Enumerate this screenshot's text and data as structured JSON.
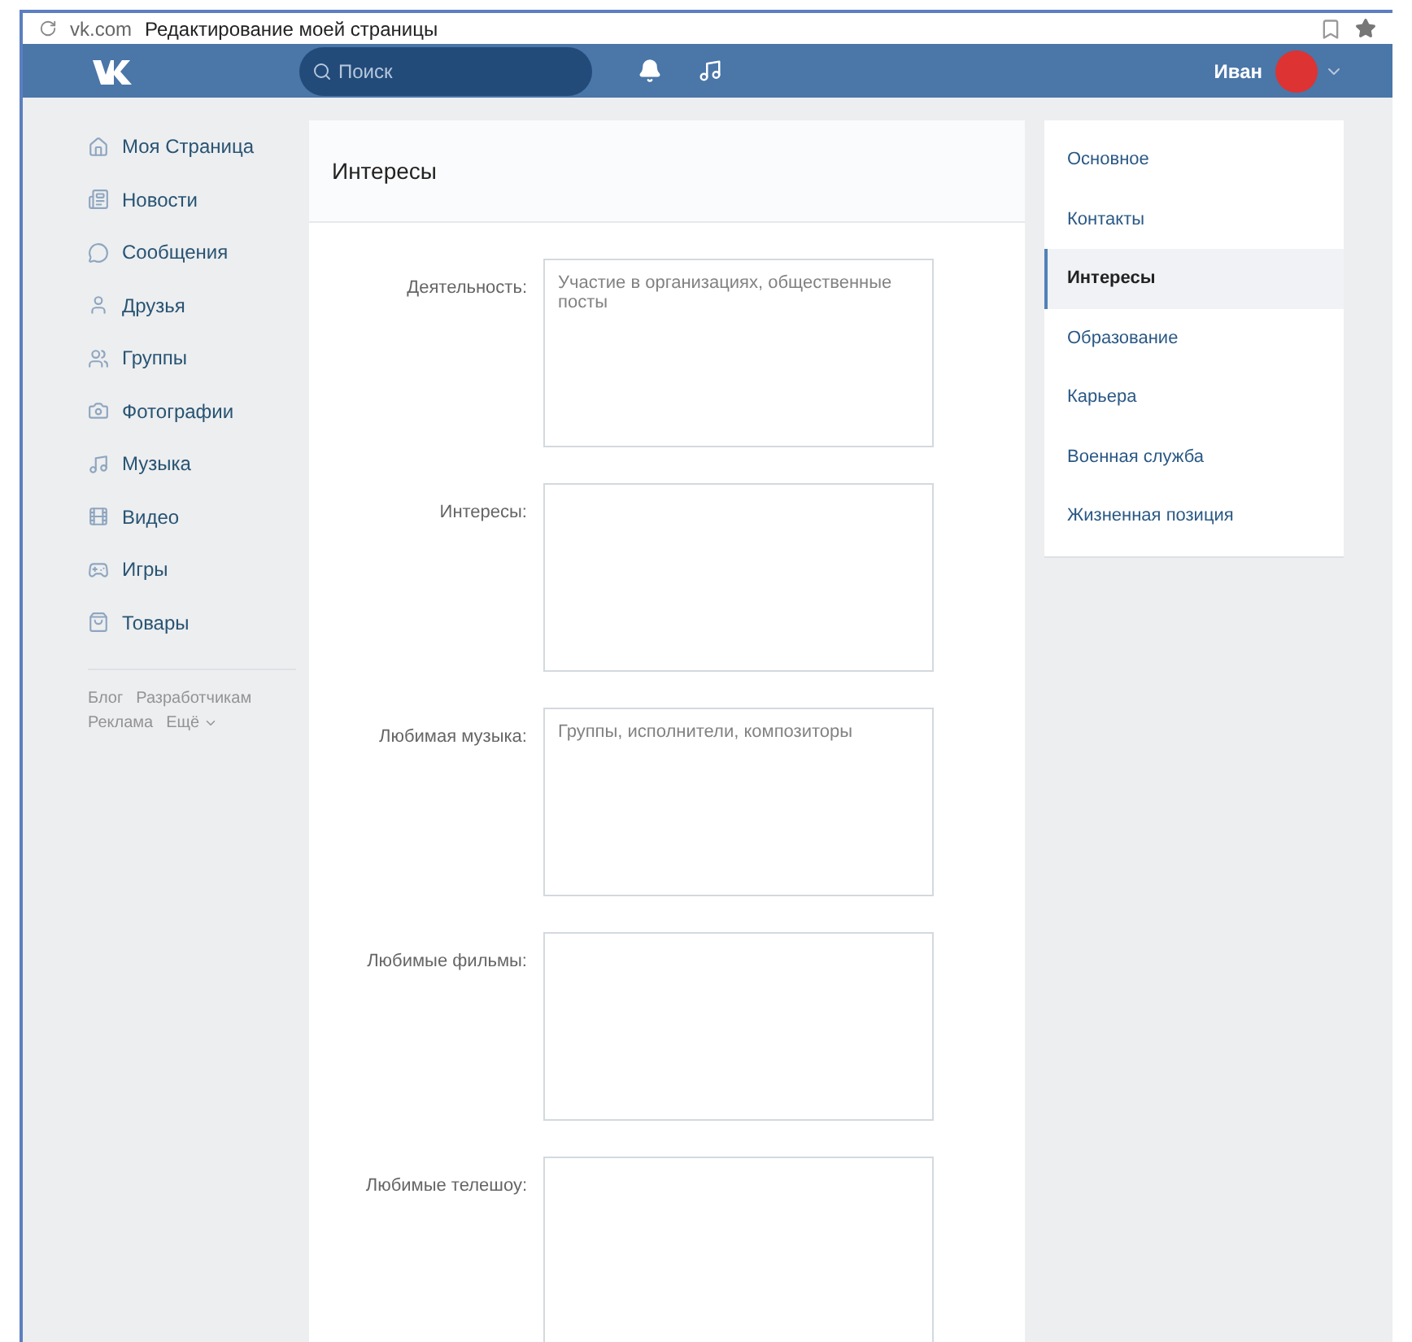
{
  "browser": {
    "domain": "vk.com",
    "title": "Редактирование моей страницы"
  },
  "header": {
    "search": {
      "placeholder": "Поиск"
    },
    "user": {
      "name": "Иван"
    }
  },
  "sidebar": {
    "items": [
      {
        "label": "Моя Страница"
      },
      {
        "label": "Новости"
      },
      {
        "label": "Сообщения"
      },
      {
        "label": "Друзья"
      },
      {
        "label": "Группы"
      },
      {
        "label": "Фотографии"
      },
      {
        "label": "Музыка"
      },
      {
        "label": "Видео"
      },
      {
        "label": "Игры"
      },
      {
        "label": "Товары"
      }
    ],
    "footer_links": [
      "Блог",
      "Разработчикам",
      "Реклама",
      "Ещё"
    ]
  },
  "panel": {
    "title": "Интересы",
    "fields": [
      {
        "label": "Деятельность:",
        "placeholder": "Участие в организациях, общественные посты"
      },
      {
        "label": "Интересы:"
      },
      {
        "label": "Любимая музыка:",
        "placeholder": "Группы, исполнители, композиторы"
      },
      {
        "label": "Любимые фильмы:"
      },
      {
        "label": "Любимые телешоу:"
      }
    ]
  },
  "nav": {
    "items": [
      {
        "label": "Основное",
        "selected": false
      },
      {
        "label": "Контакты",
        "selected": false
      },
      {
        "label": "Интересы",
        "selected": true
      },
      {
        "label": "Образование",
        "selected": false
      },
      {
        "label": "Карьера",
        "selected": false
      },
      {
        "label": "Военная служба",
        "selected": false
      },
      {
        "label": "Жизненная позиция",
        "selected": false
      }
    ]
  }
}
